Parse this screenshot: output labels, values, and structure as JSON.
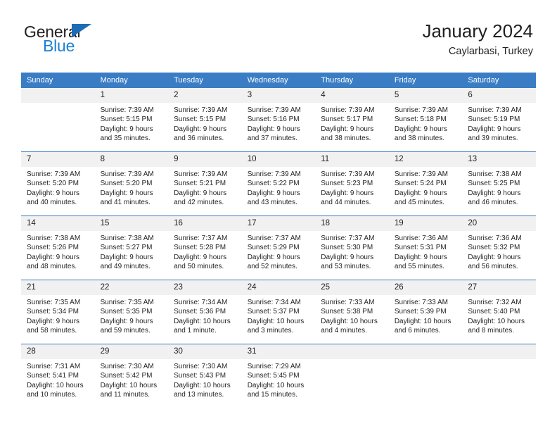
{
  "brand": {
    "name_part1": "General",
    "name_part2": "Blue",
    "triangle_color": "#1d6cb5",
    "blue_color": "#1d7fd4"
  },
  "header": {
    "title": "January 2024",
    "subtitle": "Caylarbasi, Turkey"
  },
  "theme": {
    "header_bg": "#3a7dc4",
    "daynum_bg": "#f1f1f1",
    "grid_line": "#3a7dc4",
    "text": "#231f20"
  },
  "weekday_headers": [
    "Sunday",
    "Monday",
    "Tuesday",
    "Wednesday",
    "Thursday",
    "Friday",
    "Saturday"
  ],
  "weeks": [
    [
      {
        "day": "",
        "lines": [
          "",
          "",
          "",
          ""
        ],
        "blank": true
      },
      {
        "day": "1",
        "lines": [
          "Sunrise: 7:39 AM",
          "Sunset: 5:15 PM",
          "Daylight: 9 hours",
          "and 35 minutes."
        ]
      },
      {
        "day": "2",
        "lines": [
          "Sunrise: 7:39 AM",
          "Sunset: 5:15 PM",
          "Daylight: 9 hours",
          "and 36 minutes."
        ]
      },
      {
        "day": "3",
        "lines": [
          "Sunrise: 7:39 AM",
          "Sunset: 5:16 PM",
          "Daylight: 9 hours",
          "and 37 minutes."
        ]
      },
      {
        "day": "4",
        "lines": [
          "Sunrise: 7:39 AM",
          "Sunset: 5:17 PM",
          "Daylight: 9 hours",
          "and 38 minutes."
        ]
      },
      {
        "day": "5",
        "lines": [
          "Sunrise: 7:39 AM",
          "Sunset: 5:18 PM",
          "Daylight: 9 hours",
          "and 38 minutes."
        ]
      },
      {
        "day": "6",
        "lines": [
          "Sunrise: 7:39 AM",
          "Sunset: 5:19 PM",
          "Daylight: 9 hours",
          "and 39 minutes."
        ]
      }
    ],
    [
      {
        "day": "7",
        "lines": [
          "Sunrise: 7:39 AM",
          "Sunset: 5:20 PM",
          "Daylight: 9 hours",
          "and 40 minutes."
        ]
      },
      {
        "day": "8",
        "lines": [
          "Sunrise: 7:39 AM",
          "Sunset: 5:20 PM",
          "Daylight: 9 hours",
          "and 41 minutes."
        ]
      },
      {
        "day": "9",
        "lines": [
          "Sunrise: 7:39 AM",
          "Sunset: 5:21 PM",
          "Daylight: 9 hours",
          "and 42 minutes."
        ]
      },
      {
        "day": "10",
        "lines": [
          "Sunrise: 7:39 AM",
          "Sunset: 5:22 PM",
          "Daylight: 9 hours",
          "and 43 minutes."
        ]
      },
      {
        "day": "11",
        "lines": [
          "Sunrise: 7:39 AM",
          "Sunset: 5:23 PM",
          "Daylight: 9 hours",
          "and 44 minutes."
        ]
      },
      {
        "day": "12",
        "lines": [
          "Sunrise: 7:39 AM",
          "Sunset: 5:24 PM",
          "Daylight: 9 hours",
          "and 45 minutes."
        ]
      },
      {
        "day": "13",
        "lines": [
          "Sunrise: 7:38 AM",
          "Sunset: 5:25 PM",
          "Daylight: 9 hours",
          "and 46 minutes."
        ]
      }
    ],
    [
      {
        "day": "14",
        "lines": [
          "Sunrise: 7:38 AM",
          "Sunset: 5:26 PM",
          "Daylight: 9 hours",
          "and 48 minutes."
        ]
      },
      {
        "day": "15",
        "lines": [
          "Sunrise: 7:38 AM",
          "Sunset: 5:27 PM",
          "Daylight: 9 hours",
          "and 49 minutes."
        ]
      },
      {
        "day": "16",
        "lines": [
          "Sunrise: 7:37 AM",
          "Sunset: 5:28 PM",
          "Daylight: 9 hours",
          "and 50 minutes."
        ]
      },
      {
        "day": "17",
        "lines": [
          "Sunrise: 7:37 AM",
          "Sunset: 5:29 PM",
          "Daylight: 9 hours",
          "and 52 minutes."
        ]
      },
      {
        "day": "18",
        "lines": [
          "Sunrise: 7:37 AM",
          "Sunset: 5:30 PM",
          "Daylight: 9 hours",
          "and 53 minutes."
        ]
      },
      {
        "day": "19",
        "lines": [
          "Sunrise: 7:36 AM",
          "Sunset: 5:31 PM",
          "Daylight: 9 hours",
          "and 55 minutes."
        ]
      },
      {
        "day": "20",
        "lines": [
          "Sunrise: 7:36 AM",
          "Sunset: 5:32 PM",
          "Daylight: 9 hours",
          "and 56 minutes."
        ]
      }
    ],
    [
      {
        "day": "21",
        "lines": [
          "Sunrise: 7:35 AM",
          "Sunset: 5:34 PM",
          "Daylight: 9 hours",
          "and 58 minutes."
        ]
      },
      {
        "day": "22",
        "lines": [
          "Sunrise: 7:35 AM",
          "Sunset: 5:35 PM",
          "Daylight: 9 hours",
          "and 59 minutes."
        ]
      },
      {
        "day": "23",
        "lines": [
          "Sunrise: 7:34 AM",
          "Sunset: 5:36 PM",
          "Daylight: 10 hours",
          "and 1 minute."
        ]
      },
      {
        "day": "24",
        "lines": [
          "Sunrise: 7:34 AM",
          "Sunset: 5:37 PM",
          "Daylight: 10 hours",
          "and 3 minutes."
        ]
      },
      {
        "day": "25",
        "lines": [
          "Sunrise: 7:33 AM",
          "Sunset: 5:38 PM",
          "Daylight: 10 hours",
          "and 4 minutes."
        ]
      },
      {
        "day": "26",
        "lines": [
          "Sunrise: 7:33 AM",
          "Sunset: 5:39 PM",
          "Daylight: 10 hours",
          "and 6 minutes."
        ]
      },
      {
        "day": "27",
        "lines": [
          "Sunrise: 7:32 AM",
          "Sunset: 5:40 PM",
          "Daylight: 10 hours",
          "and 8 minutes."
        ]
      }
    ],
    [
      {
        "day": "28",
        "lines": [
          "Sunrise: 7:31 AM",
          "Sunset: 5:41 PM",
          "Daylight: 10 hours",
          "and 10 minutes."
        ]
      },
      {
        "day": "29",
        "lines": [
          "Sunrise: 7:30 AM",
          "Sunset: 5:42 PM",
          "Daylight: 10 hours",
          "and 11 minutes."
        ]
      },
      {
        "day": "30",
        "lines": [
          "Sunrise: 7:30 AM",
          "Sunset: 5:43 PM",
          "Daylight: 10 hours",
          "and 13 minutes."
        ]
      },
      {
        "day": "31",
        "lines": [
          "Sunrise: 7:29 AM",
          "Sunset: 5:45 PM",
          "Daylight: 10 hours",
          "and 15 minutes."
        ]
      },
      {
        "day": "",
        "lines": [
          "",
          "",
          "",
          ""
        ],
        "blank": true
      },
      {
        "day": "",
        "lines": [
          "",
          "",
          "",
          ""
        ],
        "blank": true
      },
      {
        "day": "",
        "lines": [
          "",
          "",
          "",
          ""
        ],
        "blank": true
      }
    ]
  ]
}
